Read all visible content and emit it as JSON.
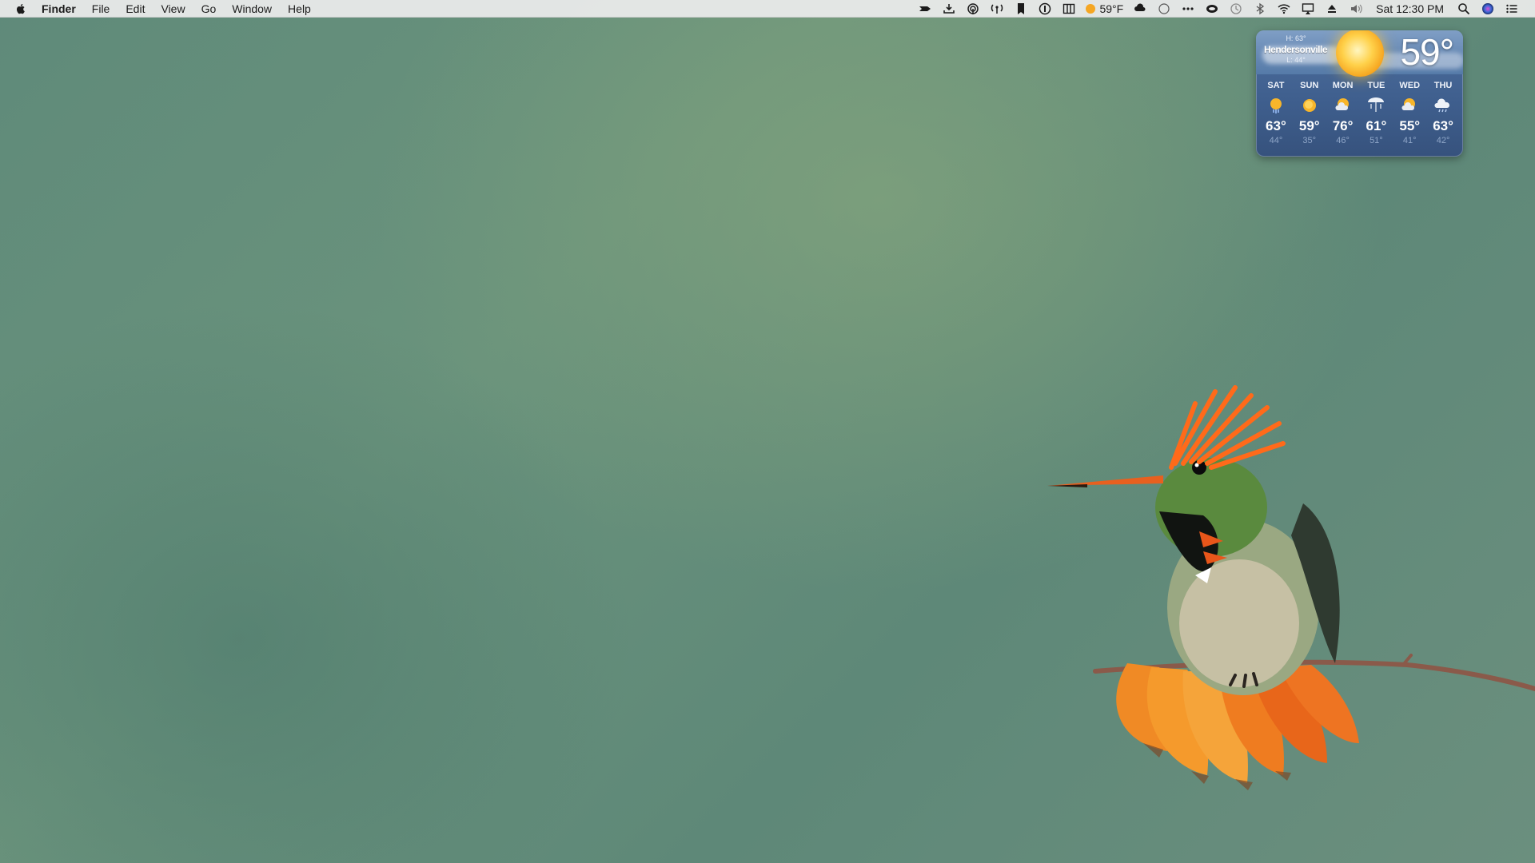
{
  "menubar": {
    "app_name": "Finder",
    "menus": [
      "File",
      "Edit",
      "View",
      "Go",
      "Window",
      "Help"
    ],
    "status_items": [
      "bartender-icon",
      "download-icon",
      "airdrop-icon",
      "wireless-signal-icon",
      "bookmark-icon",
      "onepassword-icon",
      "columns-icon"
    ],
    "temperature": "59°F",
    "status_items_after": [
      "cloud-network-icon",
      "circle-icon",
      "more-dots-icon",
      "cloud-app-icon",
      "time-machine-icon",
      "bluetooth-icon",
      "wifi-icon",
      "airplay-icon",
      "eject-icon",
      "volume-icon"
    ],
    "clock": "Sat 12:30 PM",
    "right_icons": [
      "spotlight-icon",
      "siri-icon",
      "notification-center-icon"
    ]
  },
  "weather": {
    "city": "Hendersonville",
    "high": "H: 63°",
    "low": "L: 44°",
    "current": "59°",
    "forecast": [
      {
        "day": "SAT",
        "hi": "63°",
        "lo": "44°",
        "icon": "sun-rain-icon"
      },
      {
        "day": "SUN",
        "hi": "59°",
        "lo": "35°",
        "icon": "sun-icon"
      },
      {
        "day": "MON",
        "hi": "76°",
        "lo": "46°",
        "icon": "partly-cloudy-icon"
      },
      {
        "day": "TUE",
        "hi": "61°",
        "lo": "51°",
        "icon": "rain-icon"
      },
      {
        "day": "WED",
        "hi": "55°",
        "lo": "41°",
        "icon": "partly-cloudy-icon"
      },
      {
        "day": "THU",
        "hi": "63°",
        "lo": "42°",
        "icon": "cloud-rain-icon"
      }
    ]
  },
  "colors": {
    "menubar_bg": "#ececec",
    "widget_bg": "#3f5f8e",
    "sun": "#f5a623"
  }
}
